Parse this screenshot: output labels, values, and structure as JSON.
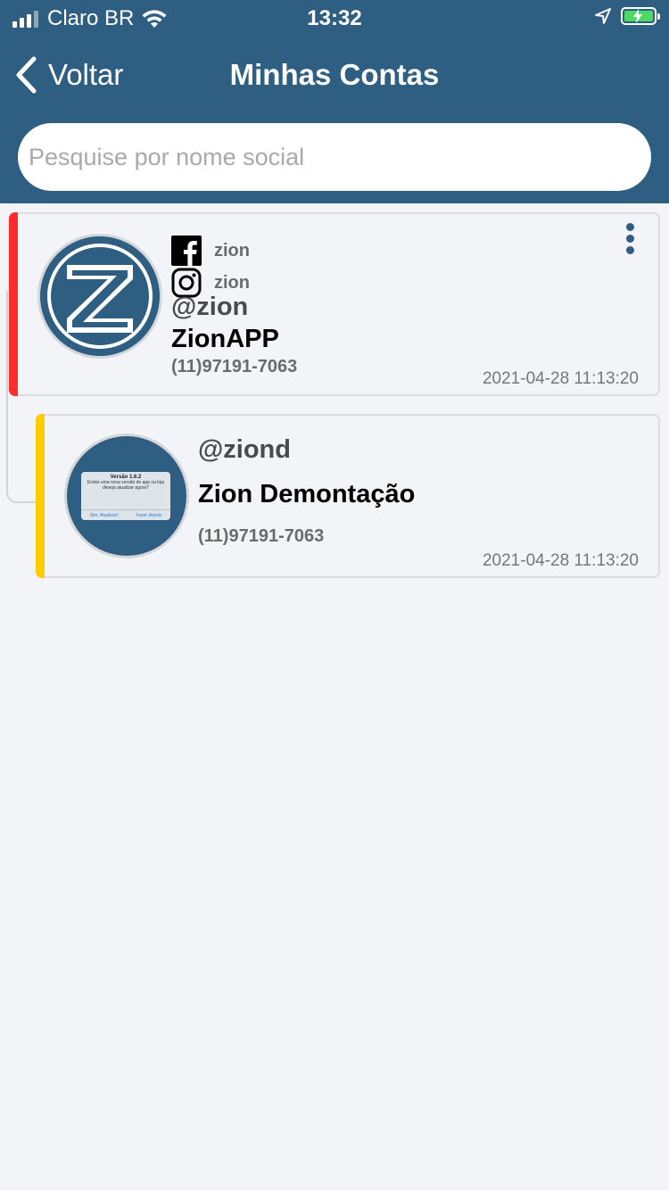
{
  "status_bar": {
    "carrier": "Claro BR",
    "time": "13:32",
    "icons": [
      "signal-icon",
      "wifi-icon",
      "location-icon",
      "battery-charging-icon"
    ]
  },
  "nav": {
    "back_label": "Voltar",
    "title": "Minhas Contas"
  },
  "search": {
    "placeholder": "Pesquise por nome social",
    "value": ""
  },
  "colors": {
    "header": "#2e5e82",
    "accent_primary": "#ff2d2d",
    "accent_secondary": "#ffcc00",
    "battery": "#4cd964"
  },
  "accounts": [
    {
      "socials": [
        {
          "icon": "facebook-icon",
          "name": "zion"
        },
        {
          "icon": "instagram-icon",
          "name": "zion"
        }
      ],
      "handle": "@zion",
      "display_name": "ZionAPP",
      "phone": "(11)97191-7063",
      "date": "2021-04-28 11:13:20",
      "avatar": "zion-logo-icon"
    },
    {
      "handle": "@ziond",
      "display_name": "Zion Demontação",
      "phone": "(11)97191-7063",
      "date": "2021-04-28 11:13:20",
      "avatar_dialog": {
        "title": "Versão 1.6.2",
        "body": "Existe uma nova versão de app na loja deseja atualizar agora?",
        "confirm": "Sim, Atualizar!",
        "cancel": "Fazer depois"
      }
    }
  ]
}
